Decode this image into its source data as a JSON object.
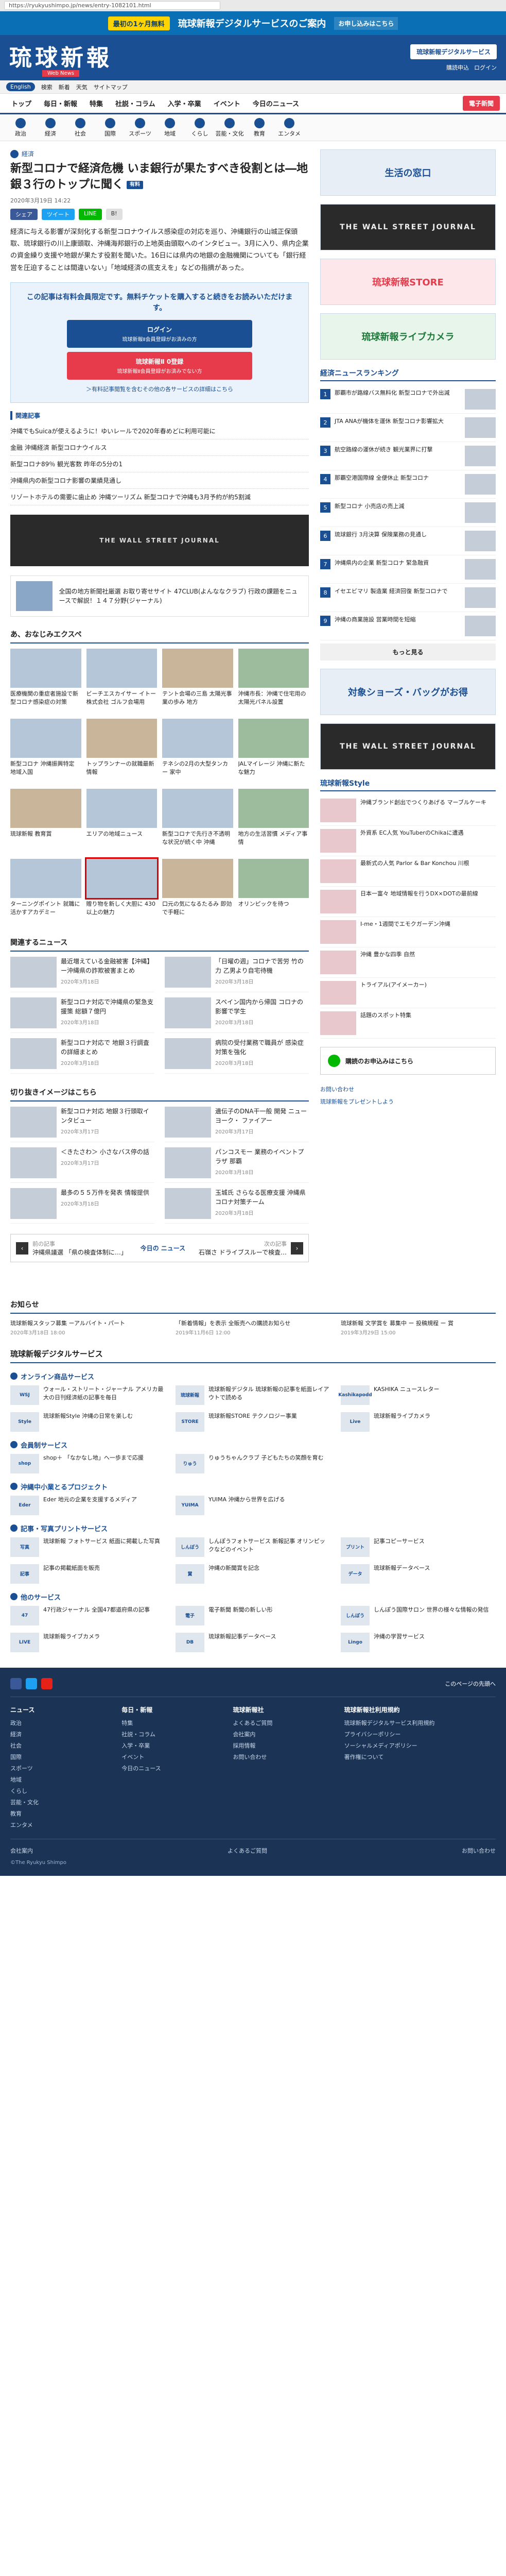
{
  "browser": {
    "url": "https://ryukyushimpo.jp/news/entry-1082101.html"
  },
  "promo": {
    "badge": "最初の1ヶ月無料",
    "text": "琉球新報デジタルサービスのご案内",
    "sub": "お申し込みはこちら"
  },
  "header": {
    "logo": "琉球新報",
    "logo_sub": "Web News",
    "digital_btn": "琉球新報デジタルサービス",
    "links": [
      "購読申込",
      "ログイン"
    ]
  },
  "util": {
    "tag": "English",
    "items": [
      "検索",
      "新着",
      "天気",
      "サイトマップ"
    ]
  },
  "gnav": {
    "items": [
      "トップ",
      "毎日・新報",
      "特集",
      "社説・コラム",
      "入学・卒業",
      "イベント",
      "今日のニュース"
    ],
    "login": "電子新聞"
  },
  "subnav": [
    "政治",
    "経済",
    "社会",
    "国際",
    "スポーツ",
    "地域",
    "くらし",
    "芸能・文化",
    "教育",
    "エンタメ"
  ],
  "article": {
    "category": "経済",
    "title": "新型コロナで経済危機 いま銀行が果たすべき役割とは―地銀３行のトップに聞く",
    "pay_badge": "有料",
    "meta": "2020年3月19日 14:22",
    "share": {
      "fb": "シェア",
      "tw": "ツイート",
      "ln": "LINE",
      "bm": "B!"
    },
    "lead": "経済に与える影響が深刻化する新型コロナウイルス感染症の対応を巡り、沖縄銀行の山城正保頭取、琉球銀行の川上康頭取、沖縄海邦銀行の上地英由頭取へのインタビュー。3月に入り、県内企業の資金繰り支援や地銀が果たす役割を聞いた。16日には県内の地銀の金融機関についても「銀行経営を圧迫することは間違いない」「地域経済の底支えを」などの指摘があった。"
  },
  "paywall": {
    "msg": "この記事は有料会員限定です。無料チケットを購入すると続きをお読みいただけます。",
    "login": "ログイン",
    "login_sub": "琉球新報Ⅱ会員登録がお済みの方",
    "register": "琉球新報Ⅱ 0登録",
    "register_sub": "琉球新報Ⅱ会員登録がお済みでない方",
    "note": "＞有料記事閲覧を含むその他の各サービスの詳細はこちら"
  },
  "related": {
    "title": "関連記事",
    "items": [
      "沖縄でもSuicaが使えるように！ゆいレールで2020年春めどに利用可能に",
      "金融 沖縄経済 新型コロナウイルス",
      "新型コロナ89％ 観光客数 昨年の5分の1",
      "沖縄県内の新型コロナ影響の業績見通し",
      "リゾートホテルの需要に歯止め 沖縄ツーリズム 新型コロナで沖縄も3月予約が約5割減"
    ]
  },
  "ads": {
    "wsj": "THE WALL STREET JOURNAL",
    "ext_text": "全国の地方新聞社厳選  お取り寄せサイト 47CLUB(よんななクラブ)  行政の課題をニュースで解説！１４７分野(ジャーナル)"
  },
  "recommend": {
    "title": "あ、おなじみエクスペ",
    "items": [
      "医療機関の重症者施設で新型コロナ感染症の対策",
      "ビーチエスカイサー イトー株式会社 ゴルフ会場用",
      "テント会場の三島 太陽光事業の歩み 地方",
      "沖縄市長：沖縄で住宅用の太陽光パネル設置",
      "新型コロナ 沖縄振興特定 地域入国",
      "トップランナーの就職最新情報",
      "テネシの2月の大型タンカー 家中",
      "JALマイレージ 沖縄に新たな魅力",
      "琉球新報 教育賞",
      "エリアの地域ニュース",
      "新型コロナで先行き不透明な状況が続く中 沖縄",
      "地方の生活習慣 メディア事情",
      "ターニングポイント 就職に活かすアカデミー",
      "贈り物を新しく大胆に 430以上の魅力",
      "口元の気になるたるみ 即効で手軽に",
      "オリンピックを待つ"
    ]
  },
  "news": {
    "title": "関連するニュース",
    "items": [
      {
        "t": "最近増えている金融被害【沖縄】 ー沖縄県の詐欺被害まとめ",
        "d": "2020年3月18日"
      },
      {
        "t": "「日曜の週」コロナで苦労 竹の力 乙男より自宅待機",
        "d": "2020年3月18日"
      },
      {
        "t": "新型コロナ対応で沖縄県の緊急支援策 総額７億円",
        "d": "2020年3月18日"
      },
      {
        "t": "スペイン国内から帰国 コロナの影響で学生",
        "d": "2020年3月18日"
      },
      {
        "t": "新型コロナ対応で 地銀３行調査の詳細まとめ",
        "d": "2020年3月18日"
      },
      {
        "t": "病院の受付業務で職員が 感染症対策を強化",
        "d": "2020年3月18日"
      }
    ]
  },
  "picks": {
    "title": "切り抜きイメージはこちら",
    "items": [
      {
        "t": "新型コロナ対応 地銀３行頭取インタビュー",
        "d": "2020年3月17日"
      },
      {
        "t": "遺伝子のDNA干一般 開発 ニューヨーク・ ファイアー",
        "d": "2020年3月17日"
      },
      {
        "t": "＜きたさわ＞ 小さなバス停の話",
        "d": "2020年3月17日"
      },
      {
        "t": "パンコスモー 業務のイベントプラザ 那覇",
        "d": "2020年3月18日"
      },
      {
        "t": "最多の５５万件を発表 情報提供",
        "d": "2020年3月18日"
      },
      {
        "t": "玉城氏 さらなる医療支援 沖縄県 コロナ対策チーム",
        "d": "2020年3月18日"
      }
    ]
  },
  "pager": {
    "prev": "前の記事",
    "prev_t": "沖縄県議選 「県の検査体制に…」",
    "cal": "今日の ニュース",
    "next": "次の記事",
    "next_t": "石嶺さ ドライブスルーで検査…"
  },
  "side": {
    "ad1": "生活の窓口",
    "wsj": "THE WALL STREET JOURNAL",
    "store": "琉球新報STORE",
    "library": "琉球新報ライブカメラ",
    "ranking_title": "経済ニュースランキング",
    "ranking": [
      "那覇市が路線バス無料化 新型コロナで外出減",
      "JTA ANAが機体を運休 新型コロナ影響拡大",
      "航空路線の運休が続き 観光業界に打撃",
      "那覇空港国際線 全便休止 新型コロナ",
      "新型コロナ 小売店の売上減",
      "琉球銀行 3月決算 保険業務の見通し",
      "沖縄県内の企業 新型コロナ 緊急融資",
      "イセエビマリ 製造業 経済回復 新型コロナで",
      "沖縄の商業施設 営業時間を短縮"
    ],
    "more": "もっと見る",
    "ad2": "対象ショーズ・バッグがお得",
    "wsj2": "THE WALL STREET JOURNAL",
    "style_title": "琉球新報Style",
    "style": [
      "沖縄ブランド創出でつくりあげる マーブルケーキ",
      "外資系 EC人気 YouTuberのChikaに遭遇",
      "最新式の人気 Parlor & Bar Konchou 川根",
      "日本一富々 地域情報を行うDX×DOTの最前線",
      "I-me・1週間でエモクガーデン沖縄",
      "沖縄 豊かな四季 自然",
      "トライアル(アイメーカー)",
      "話題のスポット特集"
    ],
    "line_login": "購読のお申込みはこちら",
    "links": [
      "お問い合わせ",
      "琉球新報をプレゼントしよう"
    ]
  },
  "notices": {
    "title": "お知らせ",
    "items": [
      {
        "n": "琉球新報スタッフ募集 ーアルバイト・パート",
        "d": "2020年3月18日 18:00"
      },
      {
        "n": "「新着情報」を表示 全販売への購読お知らせ",
        "d": "2019年11月6日 12:00"
      },
      {
        "n": "琉球新報 文学賞を 募集中 ー 投稿規程 ー 賞",
        "d": "2019年3月29日 15:00"
      }
    ]
  },
  "digital": {
    "title": "琉球新報デジタルサービス",
    "sections": [
      {
        "head": "オンライン商品サービス",
        "items": [
          {
            "logo": "WSJ",
            "t": "ウォール・ストリート・ジャーナル アメリカ最大の日刊経済紙の記事を毎日"
          },
          {
            "logo": "琉球新報",
            "t": "琉球新報デジタル 琉球新報の記事を紙面レイアウトで読める"
          },
          {
            "logo": "Kashikapodd",
            "t": "KASHIKA ニュースレター"
          },
          {
            "logo": "Style",
            "t": "琉球新報Style 沖縄の日常を楽しむ"
          },
          {
            "logo": "STORE",
            "t": "琉球新報STORE テクノロジー事業"
          },
          {
            "logo": "Live",
            "t": "琉球新報ライブカメラ"
          }
        ]
      },
      {
        "head": "会員制サービス",
        "items": [
          {
            "logo": "shop",
            "t": "shop＋ 「なかなし地」へ一歩まで応援"
          },
          {
            "logo": "りゅう",
            "t": "りゅうちゃんクラブ 子どもたちの笑顔を育む"
          }
        ]
      },
      {
        "head": "沖縄中小業とるプロジェクト",
        "items": [
          {
            "logo": "Eder",
            "t": "Eder 地元の企業を支援するメディア"
          },
          {
            "logo": "YUIMA",
            "t": "YUIMA 沖縄から世界を広げる"
          }
        ]
      },
      {
        "head": "記事・写真プリントサービス",
        "items": [
          {
            "logo": "写真",
            "t": "琉球新報 フォトサービス 紙面に掲載した写真"
          },
          {
            "logo": "しんぽう",
            "t": "しんぽうフォトサービス 新報記事 オリンピックなどのイベント"
          },
          {
            "logo": "プリント",
            "t": "記事コピーサービス"
          },
          {
            "logo": "記事",
            "t": "記事の掲載紙面を販売"
          },
          {
            "logo": "賞",
            "t": "沖縄の新聞賞を記念"
          },
          {
            "logo": "データ",
            "t": "琉球新報データベース"
          }
        ]
      },
      {
        "head": "他のサービス",
        "items": [
          {
            "logo": "47",
            "t": "47行政ジャーナル 全国47都道府県の記事"
          },
          {
            "logo": "電子",
            "t": "電子新聞 新聞の新しい形"
          },
          {
            "logo": "しんぽう",
            "t": "しんぽう国際サロン 世界の様々な情報の発信"
          },
          {
            "logo": "LIVE",
            "t": "琉球新報ライブカメラ"
          },
          {
            "logo": "DB",
            "t": "琉球新報記事データベース"
          },
          {
            "logo": "Lingo",
            "t": "沖縄の学習サービス"
          }
        ]
      }
    ]
  },
  "footer": {
    "back": "このページの先頭へ",
    "cols": [
      {
        "h": "ニュース",
        "links": [
          "政治",
          "経済",
          "社会",
          "国際",
          "スポーツ",
          "地域",
          "くらし",
          "芸能・文化",
          "教育",
          "エンタメ"
        ]
      },
      {
        "h": "毎日・新報",
        "links": [
          "特集",
          "社説・コラム",
          "入学・卒業",
          "イベント",
          "今日のニュース"
        ]
      },
      {
        "h": "琉球新報社",
        "links": [
          "よくあるご質問",
          "会社案内",
          "採用情報",
          "お問い合わせ"
        ]
      },
      {
        "h": "琉球新報社利用規約",
        "links": [
          "琉球新報デジタルサービス利用規約",
          "プライバシーポリシー",
          "ソーシャルメディアポリシー",
          "著作権について"
        ]
      }
    ],
    "bottom_left": "会社案内",
    "bottom_mid": "よくあるご質問",
    "bottom_right": "お問い合わせ",
    "copy": "©The Ryukyu Shimpo"
  }
}
